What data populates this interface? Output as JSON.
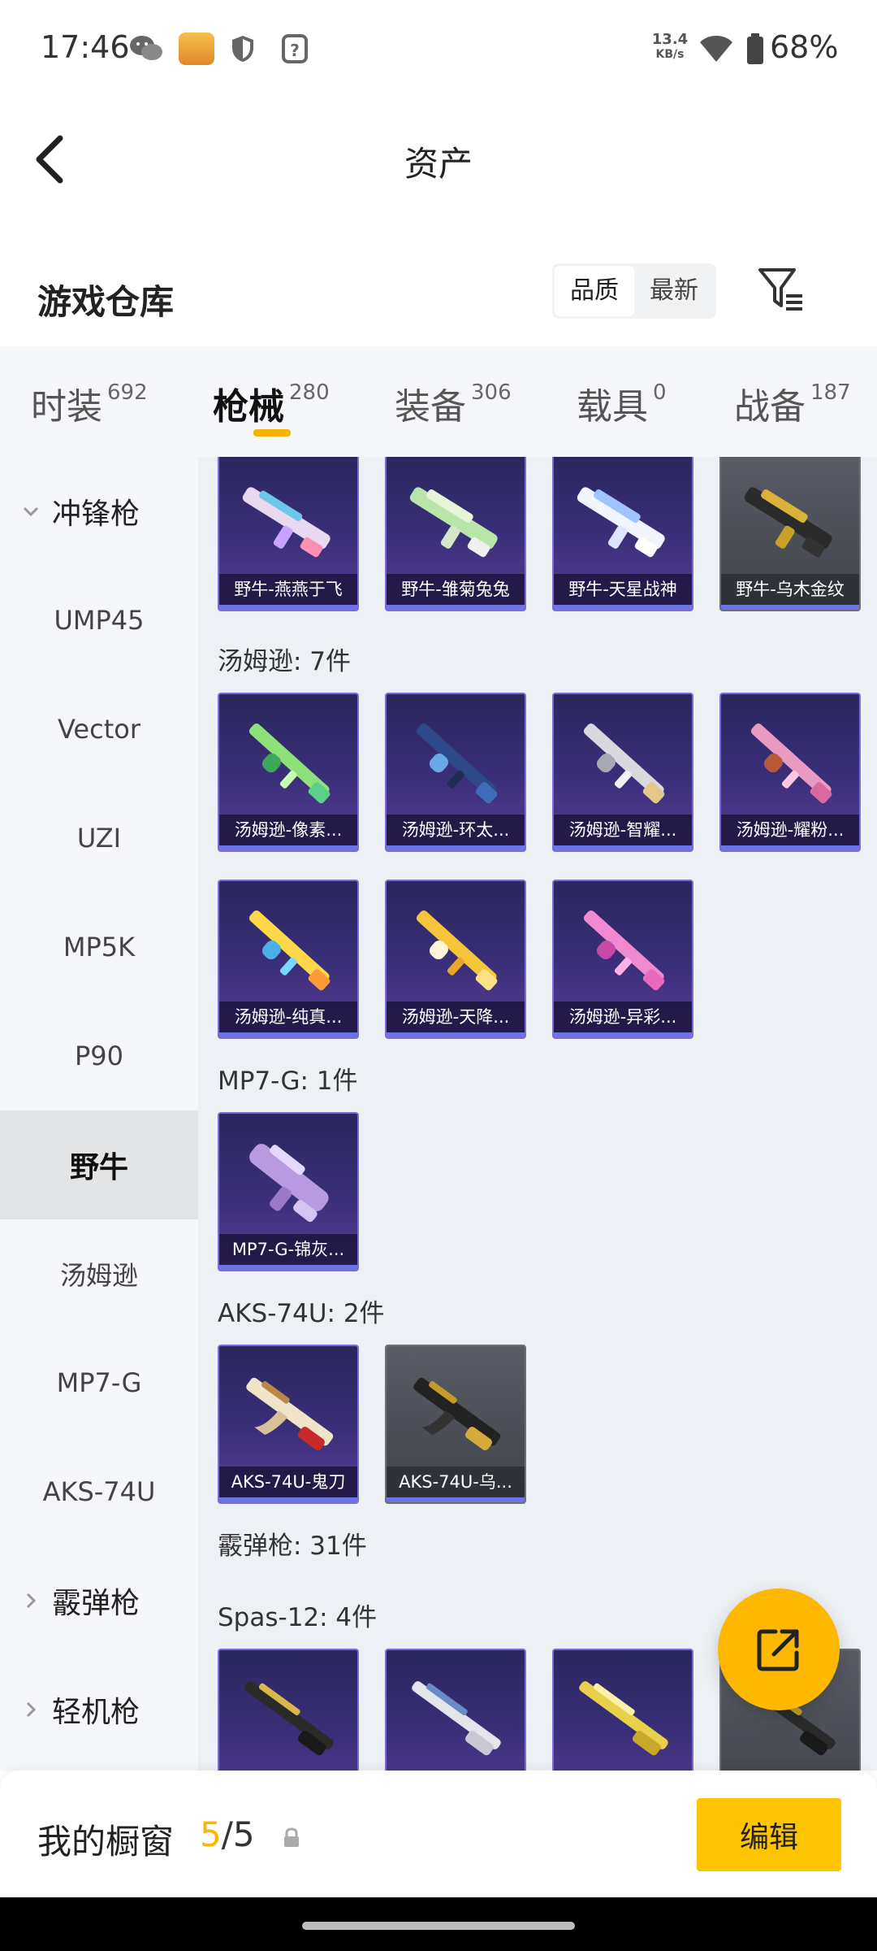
{
  "status_bar": {
    "time": "17:46",
    "net_speed_value": "13.4",
    "net_speed_unit": "KB/s",
    "battery": "68%",
    "app_icon_label": "和平营地"
  },
  "header": {
    "title": "资产"
  },
  "section": {
    "title": "游戏仓库",
    "sort_quality": "品质",
    "sort_latest": "最新"
  },
  "tabs": [
    {
      "label": "时装",
      "count": "692"
    },
    {
      "label": "枪械",
      "count": "280"
    },
    {
      "label": "装备",
      "count": "306"
    },
    {
      "label": "载具",
      "count": "0"
    },
    {
      "label": "战备",
      "count": "187"
    }
  ],
  "sidebar": {
    "items": [
      {
        "label": "冲锋枪"
      },
      {
        "label": "UMP45"
      },
      {
        "label": "Vector"
      },
      {
        "label": "UZI"
      },
      {
        "label": "MP5K"
      },
      {
        "label": "P90"
      },
      {
        "label": "野牛"
      },
      {
        "label": "汤姆逊"
      },
      {
        "label": "MP7-G"
      },
      {
        "label": "AKS-74U"
      },
      {
        "label": "霰弹枪"
      },
      {
        "label": "轻机枪"
      }
    ]
  },
  "content": {
    "row_bizon": [
      {
        "name": "野牛-燕燕于飞"
      },
      {
        "name": "野牛-雏菊兔兔"
      },
      {
        "name": "野牛-天星战神"
      },
      {
        "name": "野牛-乌木金纹"
      }
    ],
    "label_thompson": "汤姆逊: 7件",
    "row_thompson": [
      {
        "name": "汤姆逊-像素..."
      },
      {
        "name": "汤姆逊-环太..."
      },
      {
        "name": "汤姆逊-智耀..."
      },
      {
        "name": "汤姆逊-耀粉..."
      },
      {
        "name": "汤姆逊-纯真..."
      },
      {
        "name": "汤姆逊-天降..."
      },
      {
        "name": "汤姆逊-异彩..."
      }
    ],
    "label_mp7": "MP7-G: 1件",
    "row_mp7": [
      {
        "name": "MP7-G-锦灰..."
      }
    ],
    "label_aks": "AKS-74U: 2件",
    "row_aks": [
      {
        "name": "AKS-74U-鬼刀"
      },
      {
        "name": "AKS-74U-乌..."
      }
    ],
    "label_shotgun": "霰弹枪: 31件",
    "label_spas": "Spas-12: 4件"
  },
  "bottom_bar": {
    "title": "我的橱窗",
    "count_current": "5",
    "count_sep": "/",
    "count_total": "5",
    "edit_label": "编辑"
  },
  "colors": {
    "accent": "#ffc400",
    "count_highlight": "#ffb400",
    "card_purple": "#3b2f7a",
    "card_grey": "#4a4d55"
  }
}
